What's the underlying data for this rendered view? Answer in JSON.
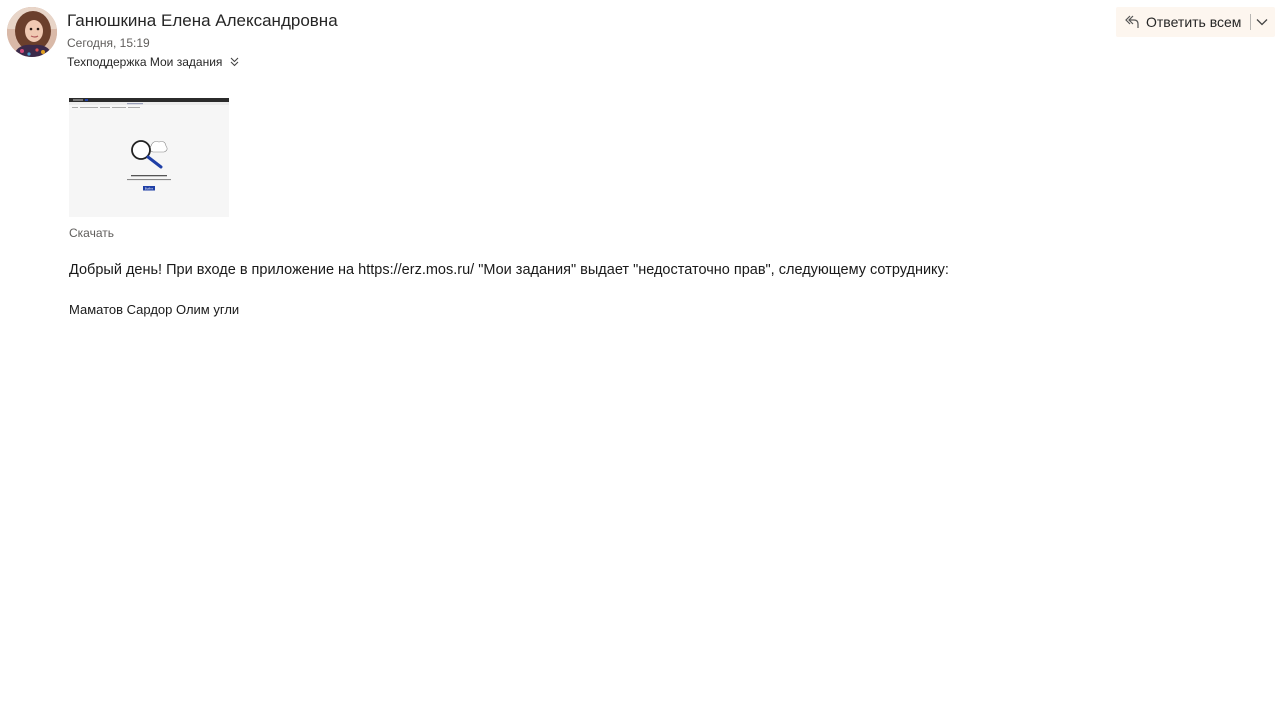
{
  "message": {
    "sender": "Ганюшкина Елена Александровна",
    "date": "Сегодня, 15:19",
    "recipients": "Техподдержка Мои задания",
    "reply_all_label": "Ответить всем",
    "attachment": {
      "download_label": "Скачать",
      "preview": {
        "button_label": "Войти"
      }
    },
    "body": {
      "line1": "Добрый день! При входе в приложение на https://erz.mos.ru/ \"Мои задания\" выдает \"недостаточно прав\",  следующему сотруднику:",
      "employee": "Маматов Сардор Олим угли"
    }
  },
  "colors": {
    "reply_button_bg": "#fdf6ef",
    "preview_button": "#1f3fa6",
    "magnifier_handle": "#1f3fa6"
  },
  "icons": {
    "reply": "reply-all-icon",
    "dropdown": "chevron-down-icon",
    "expand": "double-chevron-down-icon"
  }
}
